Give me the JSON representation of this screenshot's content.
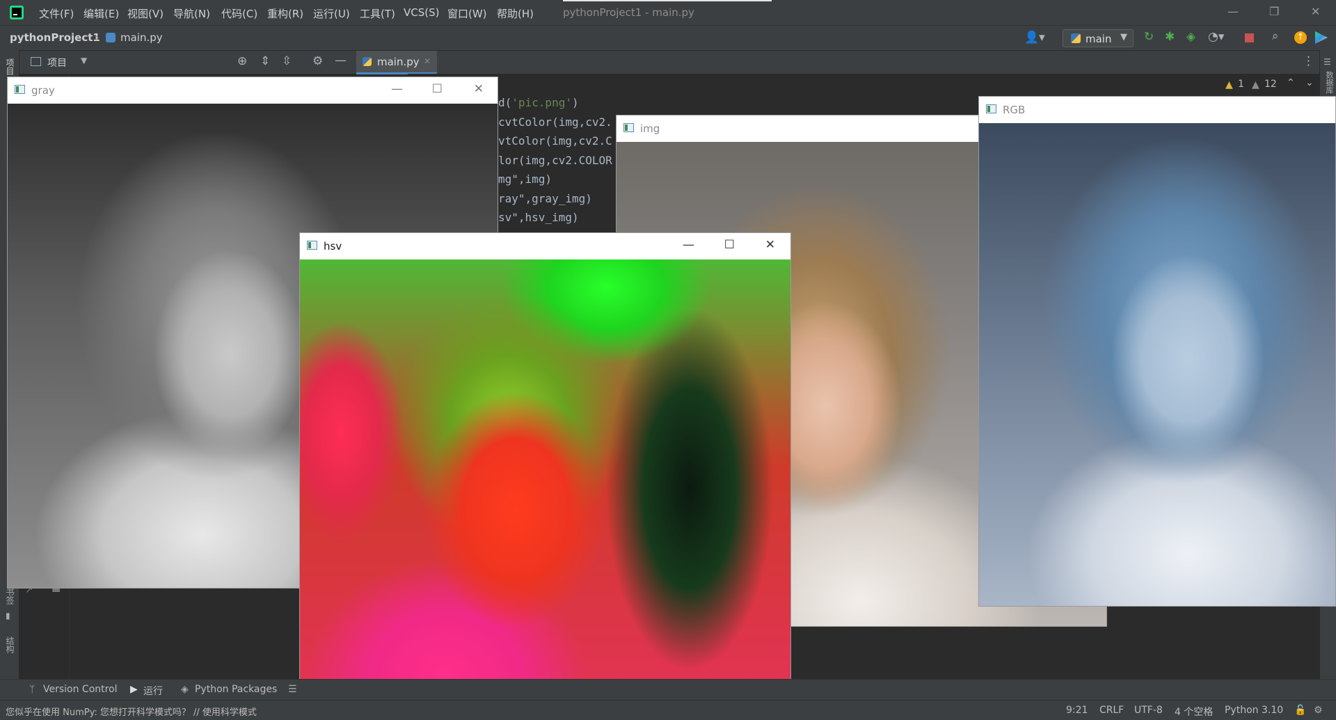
{
  "menu": [
    "文件(F)",
    "编辑(E)",
    "视图(V)",
    "导航(N)",
    "代码(C)",
    "重构(R)",
    "运行(U)",
    "工具(T)",
    "VCS(S)",
    "窗口(W)",
    "帮助(H)"
  ],
  "window_title": "pythonProject1 - main.py",
  "breadcrumb": {
    "project": "pythonProject1",
    "file": "main.py"
  },
  "run_config": "main",
  "project_panel_label": "项目",
  "editor_tab": "main.py",
  "inspections": {
    "warnings": "1",
    "weak_warnings": "12"
  },
  "code_lines": [
    [
      "d(",
      "'pic.png'",
      ")"
    ],
    [
      "cvtColor(img,cv2.",
      "",
      ""
    ],
    [
      "vtColor(img,cv2.C",
      "",
      ""
    ],
    [
      "lor(img,cv2.COLOR",
      "",
      ""
    ],
    [
      "mg\",img)",
      "",
      ""
    ],
    [
      "ray\",gray_img)",
      "",
      ""
    ],
    [
      "sv\",hsv_img)",
      "",
      ""
    ]
  ],
  "cv_windows": {
    "gray": "gray",
    "img": "img",
    "rgb": "RGB",
    "hsv": "hsv"
  },
  "bottom_tabs": [
    "Version Control",
    "运行",
    "Python Packages"
  ],
  "status": {
    "message": "您似乎在使用 NumPy: 您想打开科学模式吗？ // 使用科学模式",
    "position": "9:21",
    "line_sep": "CRLF",
    "encoding": "UTF-8",
    "indent": "4 个空格",
    "interpreter": "Python 3.10"
  },
  "left_stripe_labels": [
    "项目",
    "书签",
    "结构"
  ],
  "right_stripe_labels": [
    "数据库"
  ]
}
